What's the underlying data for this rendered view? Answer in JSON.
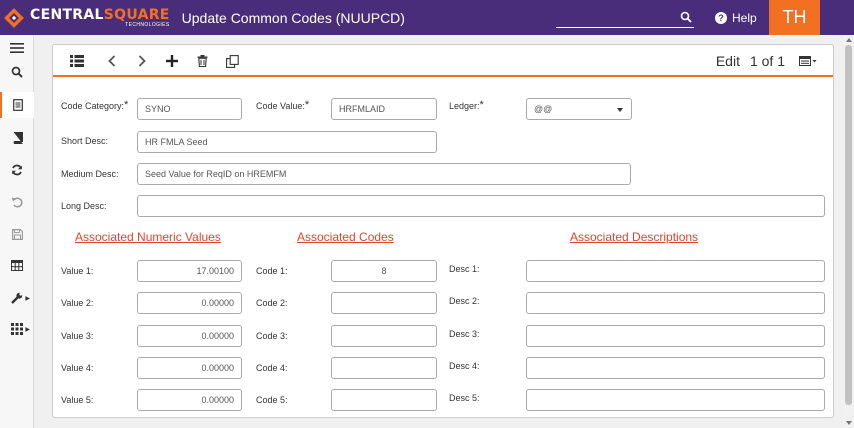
{
  "header": {
    "brand_main_a": "CENTRAL",
    "brand_main_b": "SQUARE",
    "brand_sub": "TECHNOLOGIES",
    "title": "Update Common Codes (NUUPCD)",
    "search_value": "",
    "help_label": "Help",
    "user_initials": "TH"
  },
  "colors": {
    "brand_purple": "#4a2d7a",
    "accent_orange": "#f36f21",
    "section_red": "#e0452b"
  },
  "rail": [
    "menu-icon",
    "search-icon",
    "form-icon",
    "book-icon",
    "refresh-icon",
    "undo-icon",
    "save-icon",
    "table-icon",
    "wrench-icon",
    "grid-icon"
  ],
  "toolbar": {
    "mode": "Edit",
    "record": "1 of 1",
    "icons": [
      "list-icon",
      "previous-icon",
      "next-icon",
      "add-icon",
      "delete-icon",
      "copy-icon",
      "view-menu-icon"
    ]
  },
  "form": {
    "code_category_label": "Code Category:",
    "code_category_value": "SYNO",
    "code_value_label": "Code Value:",
    "code_value_value": "HRFMLAID",
    "ledger_label": "Ledger:",
    "ledger_value": "@@",
    "required_mark": "*",
    "short_desc_label": "Short Desc:",
    "short_desc_value": "HR FMLA Seed",
    "medium_desc_label": "Medium Desc:",
    "medium_desc_value": "Seed Value for ReqID on HREMFM",
    "long_desc_label": "Long Desc:",
    "long_desc_value": ""
  },
  "sections": {
    "numeric": "Associated Numeric Values",
    "codes": "Associated Codes",
    "descriptions": "Associated Descriptions"
  },
  "rows": [
    {
      "value_label": "Value 1:",
      "value": "17.00100",
      "code_label": "Code 1:",
      "code": "8",
      "desc_label": "Desc 1:",
      "desc": ""
    },
    {
      "value_label": "Value 2:",
      "value": "0.00000",
      "code_label": "Code 2:",
      "code": "",
      "desc_label": "Desc 2:",
      "desc": ""
    },
    {
      "value_label": "Value 3:",
      "value": "0.00000",
      "code_label": "Code 3:",
      "code": "",
      "desc_label": "Desc 3:",
      "desc": ""
    },
    {
      "value_label": "Value 4:",
      "value": "0.00000",
      "code_label": "Code 4:",
      "code": "",
      "desc_label": "Desc 4:",
      "desc": ""
    },
    {
      "value_label": "Value 5:",
      "value": "0.00000",
      "code_label": "Code 5:",
      "code": "",
      "desc_label": "Desc 5:",
      "desc": ""
    }
  ]
}
